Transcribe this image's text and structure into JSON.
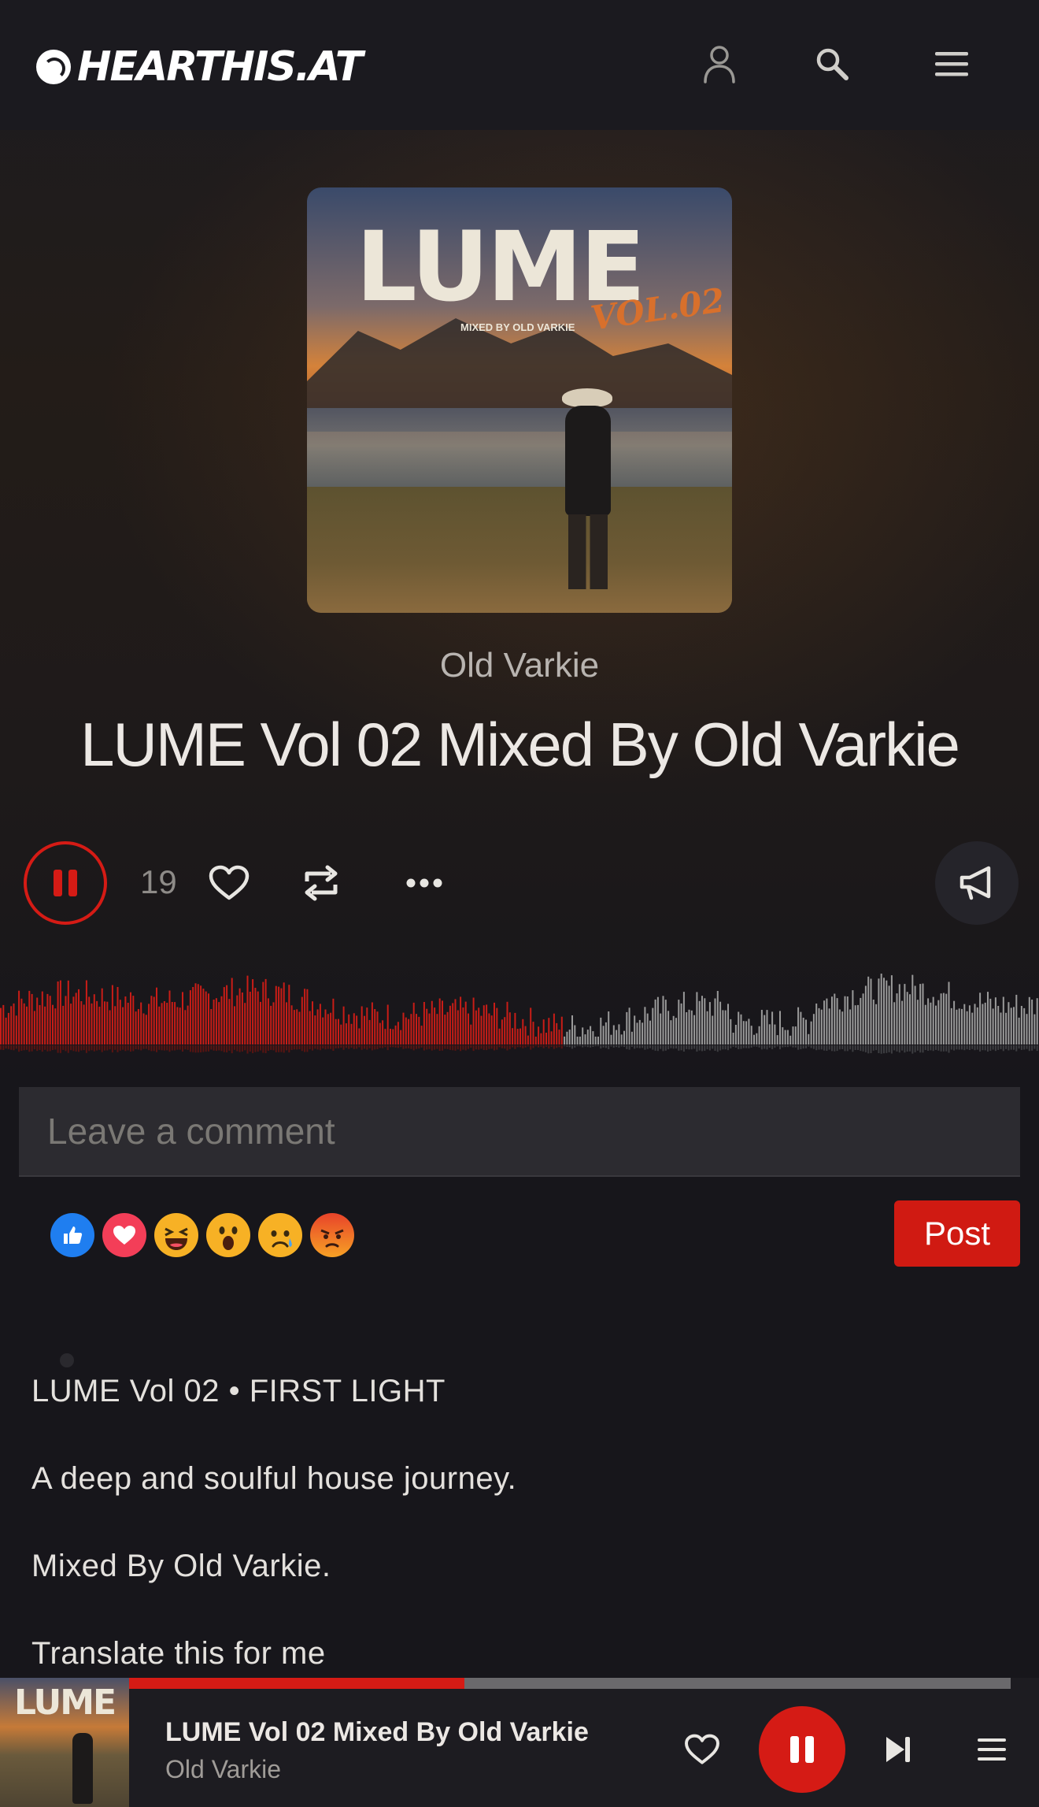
{
  "header": {
    "logo_text": "HEARTHIS.AT",
    "icons": [
      "user-icon",
      "search-icon",
      "menu-icon"
    ]
  },
  "artwork": {
    "title": "LUME",
    "subtitle": "MIXED BY OLD VARKIE",
    "vol": "VOL.02"
  },
  "track": {
    "artist": "Old Varkie",
    "title": "LUME Vol 02 Mixed By Old Varkie",
    "play_count": "19"
  },
  "waveform": {
    "played_fraction": 0.54,
    "colors": {
      "played": "#c91d17",
      "unplayed": "#9a9a9a"
    }
  },
  "comment": {
    "placeholder": "Leave a comment",
    "post_label": "Post",
    "reactions": [
      "like-reaction",
      "love-reaction",
      "haha-reaction",
      "wow-reaction",
      "sad-reaction",
      "angry-reaction"
    ]
  },
  "description": {
    "lines": [
      "LUME Vol 02 • FIRST LIGHT",
      "A deep and soulful house journey.",
      "Mixed By Old Varkie.",
      "Translate this for me"
    ]
  },
  "player": {
    "title": "LUME Vol 02 Mixed By Old Varkie",
    "artist": "Old Varkie",
    "progress": 0.38,
    "mini_art_title": "LUME"
  },
  "colors": {
    "accent": "#d51b15",
    "background": "#17161b"
  }
}
